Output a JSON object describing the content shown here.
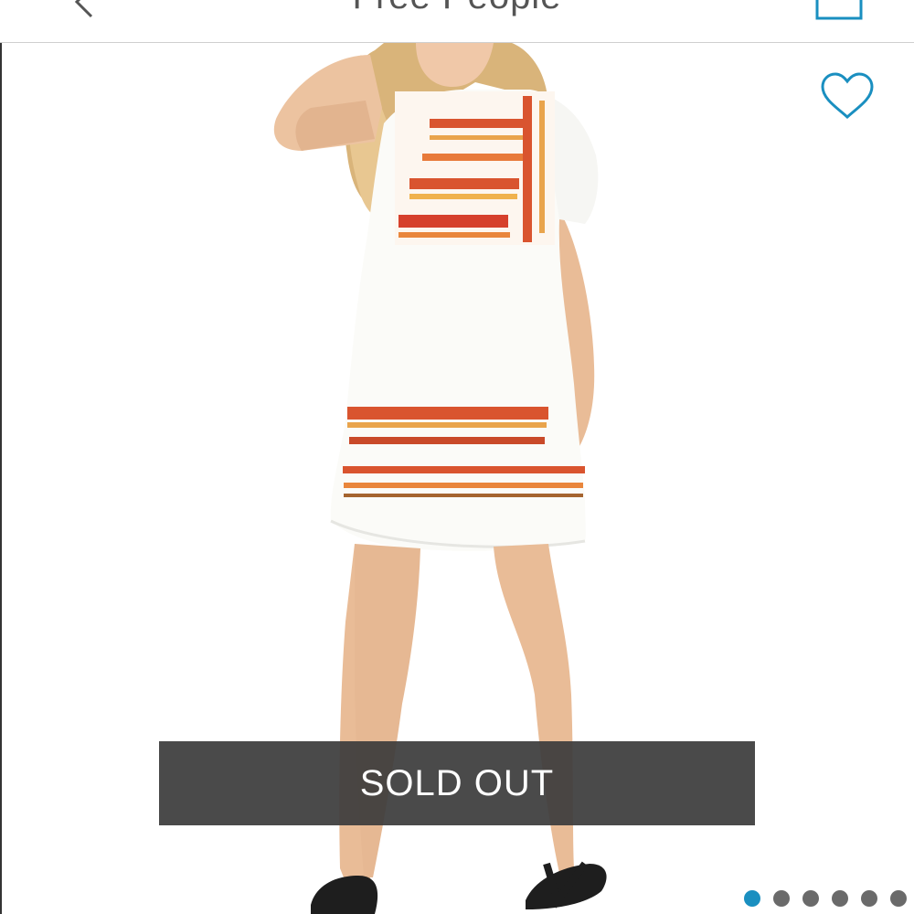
{
  "header": {
    "title": "Free People",
    "back_icon": "chevron-left-icon",
    "bag_icon": "shopping-bag-icon"
  },
  "product": {
    "image_alt": "Model wearing white embroidered tunic dress with short sleeves and ruffle hem, black sandals",
    "favorite_icon": "heart-outline-icon",
    "status_label": "SOLD OUT"
  },
  "carousel": {
    "total": 6,
    "active_index": 0
  },
  "colors": {
    "accent": "#1a8fc0",
    "banner_bg": "#3c3c3c",
    "dot_inactive": "#6a6a6a"
  }
}
